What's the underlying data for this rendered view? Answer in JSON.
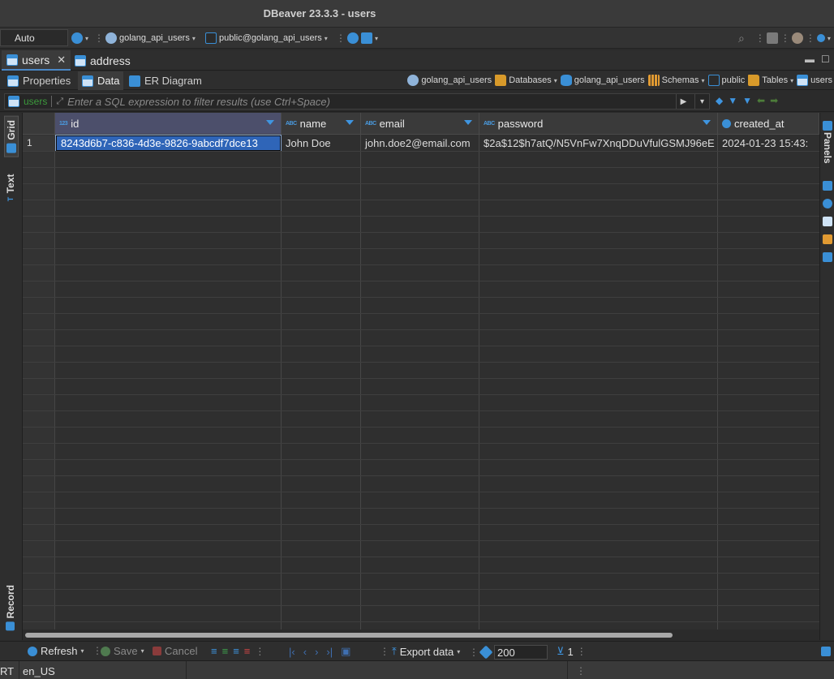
{
  "window": {
    "title": "DBeaver 23.3.3 - users"
  },
  "toolbar": {
    "transaction_mode": "Auto",
    "datasource": "golang_api_users",
    "schema": "public@golang_api_users"
  },
  "editor_tabs": [
    {
      "label": "users",
      "active": true
    },
    {
      "label": "address",
      "active": false
    }
  ],
  "sub_tabs": [
    {
      "label": "Properties"
    },
    {
      "label": "Data",
      "active": true
    },
    {
      "label": "ER Diagram"
    }
  ],
  "breadcrumb": [
    "golang_api_users",
    "Databases",
    "golang_api_users",
    "Schemas",
    "public",
    "Tables",
    "users"
  ],
  "filter": {
    "table": "users",
    "placeholder": "Enter a SQL expression to filter results (use Ctrl+Space)"
  },
  "left_tabs": {
    "grid": "Grid",
    "text": "Text",
    "record": "Record"
  },
  "right_panel": {
    "label": "Panels"
  },
  "grid": {
    "columns": [
      {
        "name": "id",
        "type_badge": "123"
      },
      {
        "name": "name",
        "type_badge": "ABC"
      },
      {
        "name": "email",
        "type_badge": "ABC"
      },
      {
        "name": "password",
        "type_badge": "ABC"
      },
      {
        "name": "created_at",
        "type_badge": ""
      }
    ],
    "rows": [
      {
        "num": "1",
        "cells": [
          "8243d6b7-c836-4d3e-9826-9abcdf7dce13",
          "John Doe",
          "john.doe2@email.com",
          "$2a$12$h7atQ/N5VnFw7XnqDDuVfulGSMJ96eE",
          "2024-01-23 15:43:"
        ]
      }
    ]
  },
  "bottom": {
    "refresh": "Refresh",
    "save": "Save",
    "cancel": "Cancel",
    "export": "Export data",
    "fetch_size": "200",
    "row_count": "1"
  },
  "status": {
    "left": "RT",
    "locale": "en_US"
  },
  "colors": {
    "accent": "#3a8fd6",
    "selection": "#2f65b8",
    "header_selected": "#4c4f6b"
  }
}
